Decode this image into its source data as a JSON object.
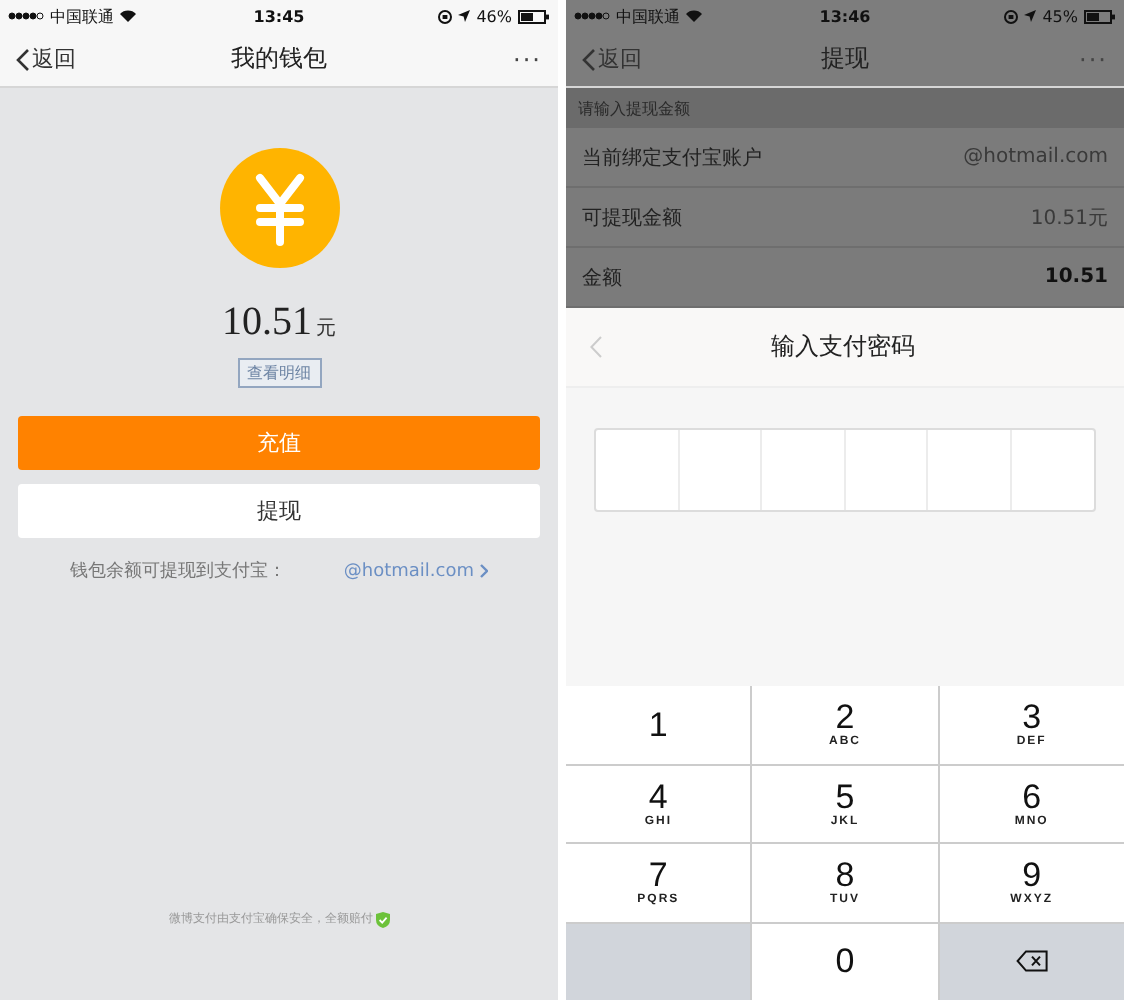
{
  "left_screen": {
    "status_bar": {
      "carrier": "中国联通",
      "time": "13:45",
      "battery": "46%"
    },
    "nav": {
      "back": "返回",
      "title": "我的钱包",
      "more": "···"
    },
    "balance": {
      "amount": "10.51",
      "unit": "元"
    },
    "details_button": "查看明细",
    "buttons": [
      {
        "label": "充值",
        "kind": "primary"
      },
      {
        "label": "提现",
        "kind": "secondary"
      }
    ],
    "alipay_note": {
      "label": "钱包余额可提现到支付宝：",
      "account": "@hotmail.com"
    },
    "footer": "微博支付由支付宝确保安全，全额赔付"
  },
  "right_screen": {
    "status_bar": {
      "carrier": "中国联通",
      "time": "13:46",
      "battery": "45%"
    },
    "nav": {
      "back": "返回",
      "title": "提现",
      "more": "···"
    },
    "hint": "请输入提现金额",
    "rows": [
      {
        "label": "当前绑定支付宝账户",
        "value": "@hotmail.com",
        "kind": "info"
      },
      {
        "label": "可提现金额",
        "value": "10.51元",
        "kind": "info"
      },
      {
        "label": "金额",
        "value": "10.51",
        "kind": "input"
      }
    ],
    "password_dialog": {
      "title": "输入支付密码"
    },
    "keypad": [
      {
        "kind": "digit",
        "digit": "1"
      },
      {
        "kind": "digit",
        "digit": "2",
        "letters": "ABC"
      },
      {
        "kind": "digit",
        "digit": "3",
        "letters": "DEF"
      },
      {
        "kind": "digit",
        "digit": "4",
        "letters": "GHI"
      },
      {
        "kind": "digit",
        "digit": "5",
        "letters": "JKL"
      },
      {
        "kind": "digit",
        "digit": "6",
        "letters": "MNO"
      },
      {
        "kind": "digit",
        "digit": "7",
        "letters": "PQRS"
      },
      {
        "kind": "digit",
        "digit": "8",
        "letters": "TUV"
      },
      {
        "kind": "digit",
        "digit": "9",
        "letters": "WXYZ"
      },
      {
        "kind": "blank"
      },
      {
        "kind": "digit",
        "digit": "0"
      },
      {
        "kind": "backspace"
      }
    ]
  }
}
